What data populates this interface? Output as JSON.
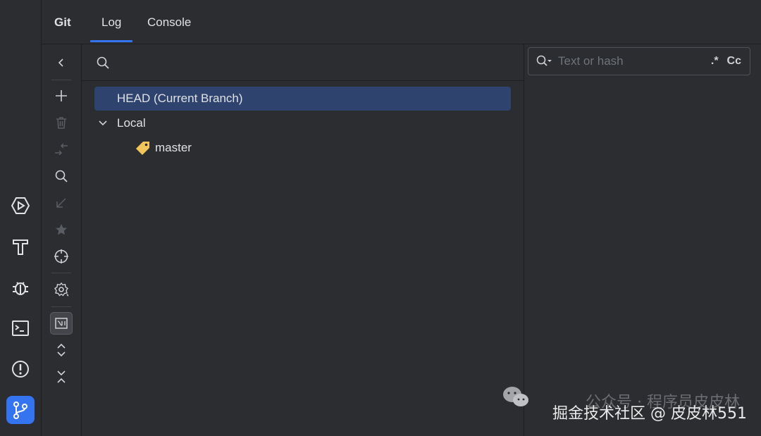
{
  "left_tools": [
    {
      "name": "run-services-icon"
    },
    {
      "name": "build-icon"
    },
    {
      "name": "debug-icon"
    },
    {
      "name": "terminal-icon"
    },
    {
      "name": "problems-icon"
    },
    {
      "name": "git-icon"
    }
  ],
  "tabs": {
    "title": "Git",
    "items": [
      "Log",
      "Console"
    ],
    "active": "Log"
  },
  "branches": {
    "head_label": "HEAD (Current Branch)",
    "local_label": "Local",
    "local_branches": [
      "master"
    ]
  },
  "log_search": {
    "placeholder": "Text or hash",
    "regex_label": ".*",
    "case_label": "Cc"
  },
  "watermark": {
    "line1": "公众号 · 程序员皮皮林",
    "line2": "掘金技术社区 @ 皮皮林551"
  },
  "colors": {
    "accent": "#3574f0",
    "selection": "#2e436e",
    "tag": "#f2c55c"
  }
}
